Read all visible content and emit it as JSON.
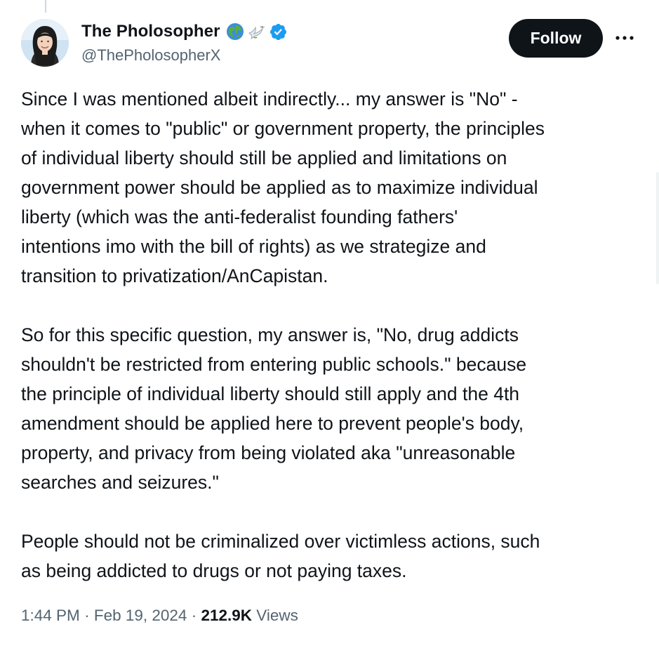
{
  "author": {
    "display_name": "The Pholosopher",
    "handle": "@ThePholosopherX",
    "badges": [
      "globe-icon",
      "dove-icon",
      "verified-badge-icon"
    ]
  },
  "actions": {
    "follow_label": "Follow",
    "more_icon": "more-horizontal-icon"
  },
  "tweet": {
    "paragraphs": [
      "Since I was mentioned albeit indirectly... my answer is \"No\" -\nwhen it comes to \"public\" or government property, the principles\nof individual liberty should still be applied and limitations on\ngovernment power should be applied as to maximize individual\nliberty (which was the anti-federalist founding fathers'\nintentions imo with the bill of rights) as we strategize and\ntransition to privatization/AnCapistan.",
      "So for this specific question, my answer is, \"No, drug addicts\nshouldn't be restricted from entering public schools.\" because\nthe principle of individual liberty should still apply and the 4th\namendment should be applied here to prevent people's body,\nproperty, and privacy from being violated aka \"unreasonable\nsearches and seizures.\"",
      "People should not be criminalized over victimless actions, such\nas being addicted to drugs or not paying taxes."
    ]
  },
  "meta": {
    "time": "1:44 PM",
    "separator": "·",
    "date": "Feb 19, 2024",
    "views_count": "212.9K",
    "views_label": "Views"
  },
  "colors": {
    "text": "#0f1419",
    "secondary": "#536471",
    "verified": "#1d9bf0",
    "follow_bg": "#0f1419"
  }
}
